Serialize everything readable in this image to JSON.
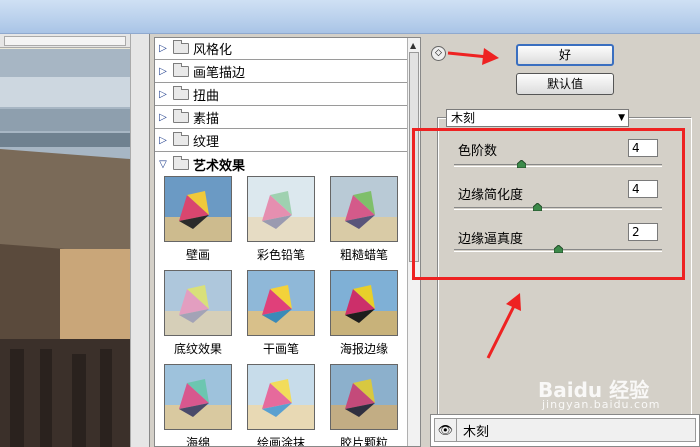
{
  "gallery": {
    "categories": [
      {
        "label": "风格化",
        "expanded": false
      },
      {
        "label": "画笔描边",
        "expanded": false
      },
      {
        "label": "扭曲",
        "expanded": false
      },
      {
        "label": "素描",
        "expanded": false
      },
      {
        "label": "纹理",
        "expanded": false
      },
      {
        "label": "艺术效果",
        "expanded": true
      }
    ],
    "filters": [
      "壁画",
      "彩色铅笔",
      "粗糙蜡笔",
      "底纹效果",
      "干画笔",
      "海报边缘",
      "海绵",
      "绘画涂抹",
      "胶片颗粒"
    ]
  },
  "buttons": {
    "ok": "好",
    "default": "默认值"
  },
  "filter_select": {
    "value": "木刻"
  },
  "params": [
    {
      "label": "色阶数",
      "value": "4"
    },
    {
      "label": "边缘简化度",
      "value": "4"
    },
    {
      "label": "边缘逼真度",
      "value": "2"
    }
  ],
  "slider_levels": [
    0.32,
    0.4,
    0.5
  ],
  "layer": {
    "name": "木刻"
  },
  "watermark": {
    "brand": "Baidu 经验",
    "url": "jingyan.baidu.com"
  },
  "annotation_color": "#e22222",
  "colors": {
    "panel": "#d4d0c8",
    "accent": "#3a6fc0"
  }
}
